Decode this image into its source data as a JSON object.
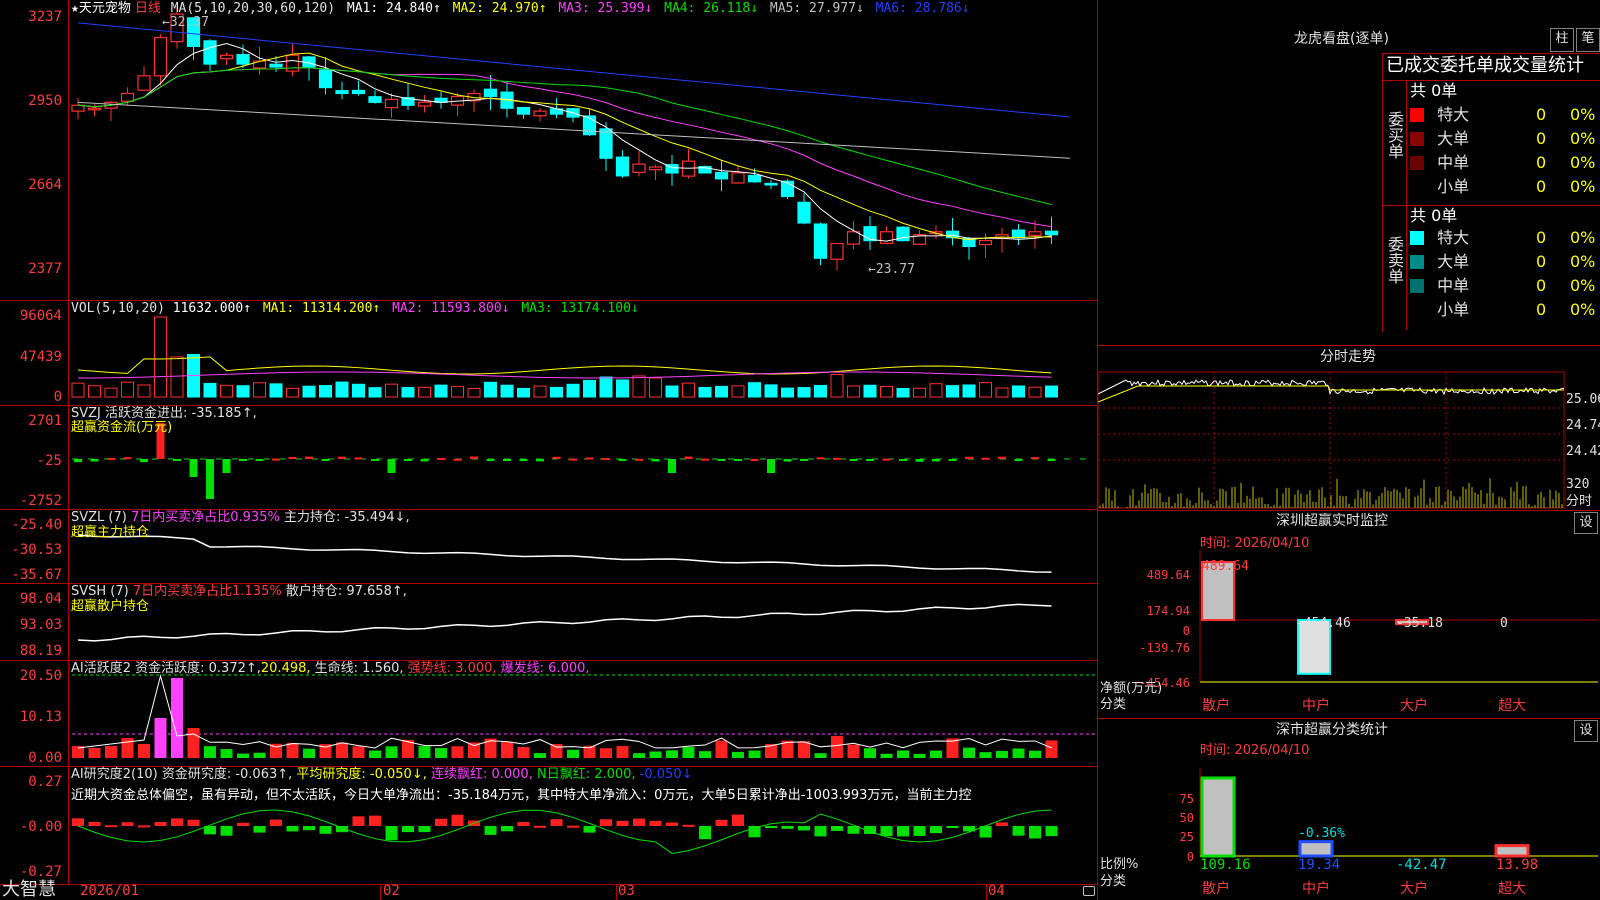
{
  "stock": {
    "star": "★",
    "name": "天元宠物",
    "period": "日线",
    "ma_label": "MA(5,10,20,30,60,120)",
    "ma1": "MA1: 24.840↑",
    "ma2": "MA2: 24.970↑",
    "ma3": "MA3: 25.399↓",
    "ma4": "MA4: 26.118↓",
    "ma5": "MA5: 27.977↓",
    "ma6": "MA6: 28.786↓",
    "high_marker": "←32.37",
    "low_marker": "←23.77"
  },
  "price_axis": [
    "3237",
    "2950",
    "2664",
    "2377"
  ],
  "volume": {
    "label": "VOL(5,10,20)",
    "value": "11632.000↑",
    "ma1": "MA1: 11314.200↑",
    "ma2": "MA2: 11593.800↓",
    "ma3": "MA3: 13174.100↓",
    "axis": [
      "96064",
      "47439",
      "0"
    ]
  },
  "svzj": {
    "label": "SVZJ  活跃资金进出: -35.185↑,",
    "sub": "超赢资金流(万元)",
    "axis": [
      "2701",
      "-25",
      "-2752"
    ]
  },
  "svzl": {
    "label_a": "SVZL (7) ",
    "label_b": "7日内买卖净占比0.935%",
    "label_c": " 主力持仓: -35.494↓,",
    "sub": "超赢主力持仓",
    "axis": [
      "-25.40",
      "-30.53",
      "-35.67"
    ]
  },
  "svsh": {
    "label_a": "SVSH (7) ",
    "label_b": "7日内买卖净占比1.135%",
    "label_c": " 散户持仓: 97.658↑,",
    "sub": "超赢散户持仓",
    "axis": [
      "98.04",
      "93.03",
      "88.19"
    ]
  },
  "ai_active": {
    "label_a": "AI活跃度2 资金活跃度: 0.372↑,",
    "label_b": "20.498,",
    "label_c": " 生命线: 1.560,",
    "label_d": " 强势线: 3.000,",
    "label_e": " 爆发线: 6.000,",
    "axis": [
      "20.50",
      "10.13",
      "0.00"
    ]
  },
  "ai_research": {
    "label_a": "AI研究度2(10) 资金研究度: -0.063↑,",
    "label_b": " 平均研究度: -0.050↓,",
    "label_c": " 连续飘红: 0.000,",
    "label_d": " N日飘红: 2.000,",
    "label_e": " -0.050↓",
    "comment": "近期大资金总体偏空，虽有异动，但不太活跃，今日大单净流出：-35.184万元，其中特大单净流入：0万元，大单5日累计净出-1003.993万元，当前主力控",
    "axis": [
      "0.27",
      "-0.00",
      "-0.27"
    ]
  },
  "dates": [
    "2026/01",
    "02",
    "03",
    "04"
  ],
  "brand": "大智慧",
  "right": {
    "lhb_title": "龙虎看盘(逐单)",
    "btn_zhu": "柱",
    "btn_bi": "笔",
    "stats_title": "已成交委托单成交量统计",
    "buy": {
      "side": "委买单",
      "total": "共 0单",
      "rows": [
        {
          "name": "特大",
          "count": "0",
          "pct": "0%",
          "color": "#ff0000"
        },
        {
          "name": "大单",
          "count": "0",
          "pct": "0%",
          "color": "#8b0000"
        },
        {
          "name": "中单",
          "count": "0",
          "pct": "0%",
          "color": "#6b0000"
        },
        {
          "name": "小单",
          "count": "0",
          "pct": "0%",
          "color": "#000000"
        }
      ]
    },
    "sell": {
      "side": "委卖单",
      "total": "共 0单",
      "rows": [
        {
          "name": "特大",
          "count": "0",
          "pct": "0%",
          "color": "#00ffff"
        },
        {
          "name": "大单",
          "count": "0",
          "pct": "0%",
          "color": "#008b8b"
        },
        {
          "name": "中单",
          "count": "0",
          "pct": "0%",
          "color": "#007070"
        },
        {
          "name": "小单",
          "count": "0",
          "pct": "0%",
          "color": "#000000"
        }
      ]
    },
    "fenshi": {
      "title": "分时走势",
      "axis": [
        "25.06",
        "24.74",
        "24.42"
      ],
      "vol": "320",
      "unit": "分时"
    },
    "sz_monitor": {
      "title": "深圳超赢实时监控",
      "btn": "设",
      "time": "时间: 2026/04/10",
      "axis": [
        "489.64",
        "174.94",
        "0",
        "-139.76",
        "-454.46"
      ],
      "unit_a": "净额(万元)",
      "unit_b": "分类",
      "cats": [
        "散户",
        "中户",
        "大户",
        "超大"
      ],
      "values": [
        489.64,
        -454.46,
        -35.18,
        0
      ],
      "labels": [
        "489.64",
        "-454.46",
        "-35.18",
        "0"
      ]
    },
    "sz_class": {
      "title": "深市超赢分类统计",
      "btn": "设",
      "time": "时间: 2026/04/10",
      "axis": [
        "75",
        "50",
        "25",
        "0"
      ],
      "unit_a": "比例%",
      "unit_b": "分类",
      "cats": [
        "散户",
        "中户",
        "大户",
        "超大"
      ],
      "values": [
        109.16,
        19.34,
        -42.47,
        13.98
      ],
      "labels": [
        "109.16",
        "19.34",
        "-42.47",
        "13.98"
      ],
      "marker": "-0.36%"
    }
  }
}
